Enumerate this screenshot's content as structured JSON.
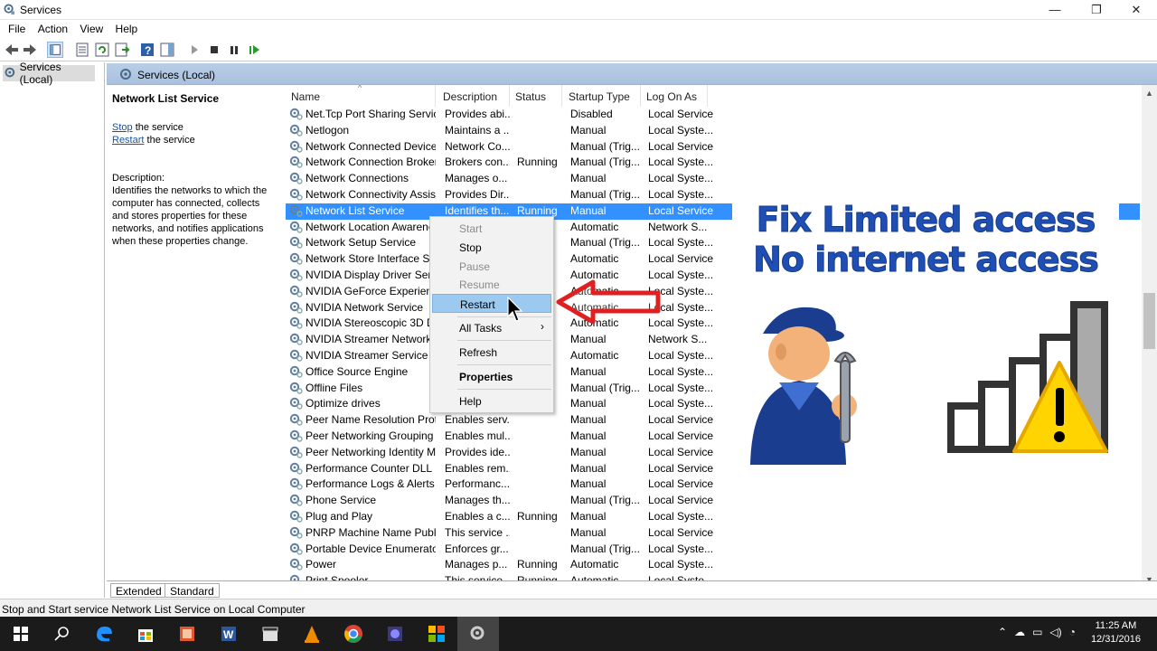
{
  "window": {
    "title": "Services",
    "minimize": "—",
    "maximize": "❐",
    "close": "✕"
  },
  "menu": [
    "File",
    "Action",
    "View",
    "Help"
  ],
  "tree": {
    "root": "Services (Local)"
  },
  "pane_header": "Services (Local)",
  "detail": {
    "service_title": "Network List Service",
    "stop_link": "Stop",
    "stop_suffix": " the service",
    "restart_link": "Restart",
    "restart_suffix": " the service",
    "desc_label": "Description:",
    "desc_text": "Identifies the networks to which the computer has connected, collects and stores properties for these networks, and notifies applications when these properties change."
  },
  "columns": [
    "Name",
    "Description",
    "Status",
    "Startup Type",
    "Log On As"
  ],
  "rows": [
    [
      "Net.Tcp Port Sharing Service",
      "Provides abi...",
      "",
      "Disabled",
      "Local Service"
    ],
    [
      "Netlogon",
      "Maintains a ...",
      "",
      "Manual",
      "Local Syste..."
    ],
    [
      "Network Connected Device...",
      "Network Co...",
      "",
      "Manual (Trig...",
      "Local Service"
    ],
    [
      "Network Connection Broker",
      "Brokers con...",
      "Running",
      "Manual (Trig...",
      "Local Syste..."
    ],
    [
      "Network Connections",
      "Manages o...",
      "",
      "Manual",
      "Local Syste..."
    ],
    [
      "Network Connectivity Assis...",
      "Provides Dir...",
      "",
      "Manual (Trig...",
      "Local Syste..."
    ],
    [
      "Network List Service",
      "Identifies th...",
      "Running",
      "Manual",
      "Local Service"
    ],
    [
      "Network Location Awarene...",
      "",
      "",
      "Automatic",
      "Network S..."
    ],
    [
      "Network Setup Service",
      "",
      "",
      "Manual (Trig...",
      "Local Syste..."
    ],
    [
      "Network Store Interface Ser...",
      "",
      "",
      "Automatic",
      "Local Service"
    ],
    [
      "NVIDIA Display Driver Servic...",
      "",
      "",
      "Automatic",
      "Local Syste..."
    ],
    [
      "NVIDIA GeForce Experience ...",
      "",
      "",
      "Automatic",
      "Local Syste..."
    ],
    [
      "NVIDIA Network Service",
      "",
      "",
      "Automatic",
      "Local Syste..."
    ],
    [
      "NVIDIA Stereoscopic 3D Dri...",
      "",
      "",
      "Automatic",
      "Local Syste..."
    ],
    [
      "NVIDIA Streamer Network S...",
      "",
      "",
      "Manual",
      "Network S..."
    ],
    [
      "NVIDIA Streamer Service",
      "",
      "",
      "Automatic",
      "Local Syste..."
    ],
    [
      "Office  Source Engine",
      "",
      "",
      "Manual",
      "Local Syste..."
    ],
    [
      "Offline Files",
      "",
      "",
      "Manual (Trig...",
      "Local Syste..."
    ],
    [
      "Optimize drives",
      "",
      "",
      "Manual",
      "Local Syste..."
    ],
    [
      "Peer Name Resolution Prot...",
      "Enables serv...",
      "",
      "Manual",
      "Local Service"
    ],
    [
      "Peer Networking Grouping",
      "Enables mul...",
      "",
      "Manual",
      "Local Service"
    ],
    [
      "Peer Networking Identity M...",
      "Provides ide...",
      "",
      "Manual",
      "Local Service"
    ],
    [
      "Performance Counter DLL ...",
      "Enables rem...",
      "",
      "Manual",
      "Local Service"
    ],
    [
      "Performance Logs & Alerts",
      "Performanc...",
      "",
      "Manual",
      "Local Service"
    ],
    [
      "Phone Service",
      "Manages th...",
      "",
      "Manual (Trig...",
      "Local Service"
    ],
    [
      "Plug and Play",
      "Enables a c...",
      "Running",
      "Manual",
      "Local Syste..."
    ],
    [
      "PNRP Machine Name Publi...",
      "This service ...",
      "",
      "Manual",
      "Local Service"
    ],
    [
      "Portable Device Enumerator...",
      "Enforces gr...",
      "",
      "Manual (Trig...",
      "Local Syste..."
    ],
    [
      "Power",
      "Manages p...",
      "Running",
      "Automatic",
      "Local Syste..."
    ],
    [
      "Print Spooler",
      "This service ...",
      "Running",
      "Automatic",
      "Local Syste..."
    ]
  ],
  "context_menu": {
    "start": "Start",
    "stop": "Stop",
    "pause": "Pause",
    "resume": "Resume",
    "restart": "Restart",
    "all_tasks": "All Tasks",
    "all_tasks_arrow": "›",
    "refresh": "Refresh",
    "properties": "Properties",
    "help": "Help"
  },
  "tabs": [
    "Extended",
    "Standard"
  ],
  "status_text": "Stop and Start service Network List Service on Local Computer",
  "promo": {
    "line1": "Fix Limited access",
    "line2": "No internet access"
  },
  "clock": {
    "time": "11:25 AM",
    "date": "12/31/2016"
  },
  "colors": {
    "selection": "#3390ff",
    "pane_header": "#b9cde6",
    "promo_text": "#1f4fb4",
    "arrow": "#e02020",
    "taskbar": "#1b1b1b"
  }
}
